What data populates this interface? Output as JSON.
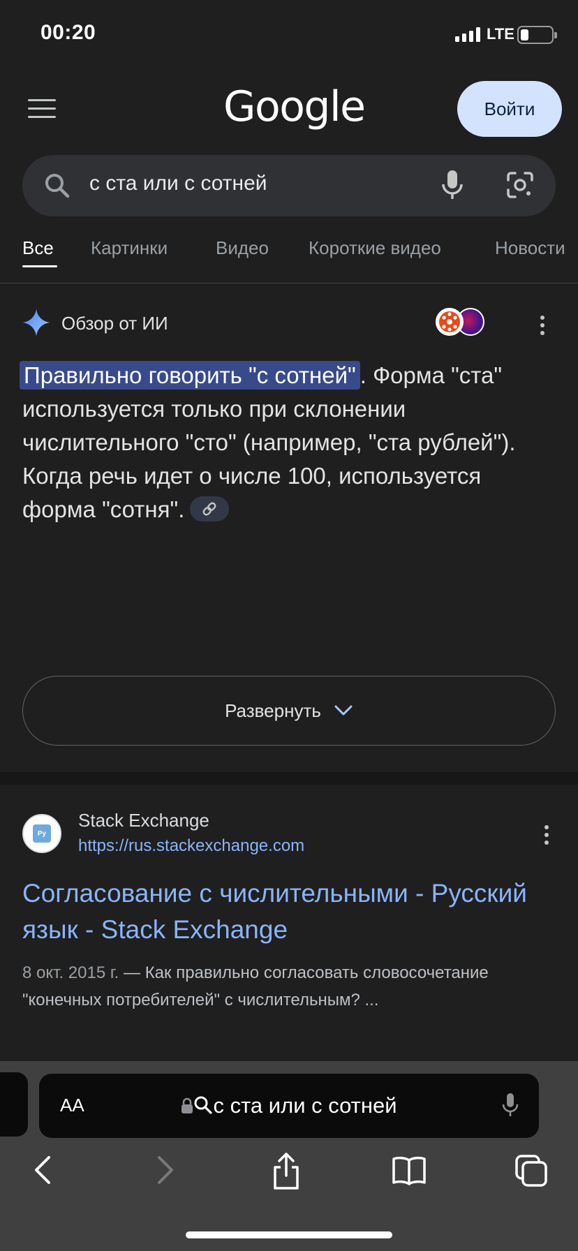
{
  "status": {
    "time": "00:20",
    "network": "LTE"
  },
  "header": {
    "logo": "Google",
    "signin_label": "Войти"
  },
  "search": {
    "query": "с ста или с сотней"
  },
  "tabs": [
    {
      "label": "Все",
      "active": true
    },
    {
      "label": "Картинки"
    },
    {
      "label": "Видео"
    },
    {
      "label": "Короткие видео"
    },
    {
      "label": "Новости"
    }
  ],
  "ai_overview": {
    "title": "Обзор от ИИ",
    "highlight": "Правильно говорить \"с сотней\"",
    "body": ". Форма \"ста\" используется только при склонении числительного \"сто\" (например, \"ста рублей\"). Когда речь идет о числе 100, используется форма \"сотня\".",
    "expand_label": "Развернуть"
  },
  "result": {
    "favicon_text": "Py",
    "site_name": "Stack Exchange",
    "url": "https://rus.stackexchange.com",
    "title": "Согласование с числительными - Русский язык - Stack Exchange",
    "date": "8 окт. 2015 г.",
    "snippet": " — Как правильно согласовать словосочетание \"конечных потребителей\" с числительным? ..."
  },
  "browser": {
    "text_size_label": "AA",
    "address_text": "с ста или с сотней"
  },
  "colors": {
    "background": "#1f1f1f",
    "link": "#8ab4f8",
    "signin_bg": "#d3e3fd",
    "highlight": "#394a8b"
  }
}
